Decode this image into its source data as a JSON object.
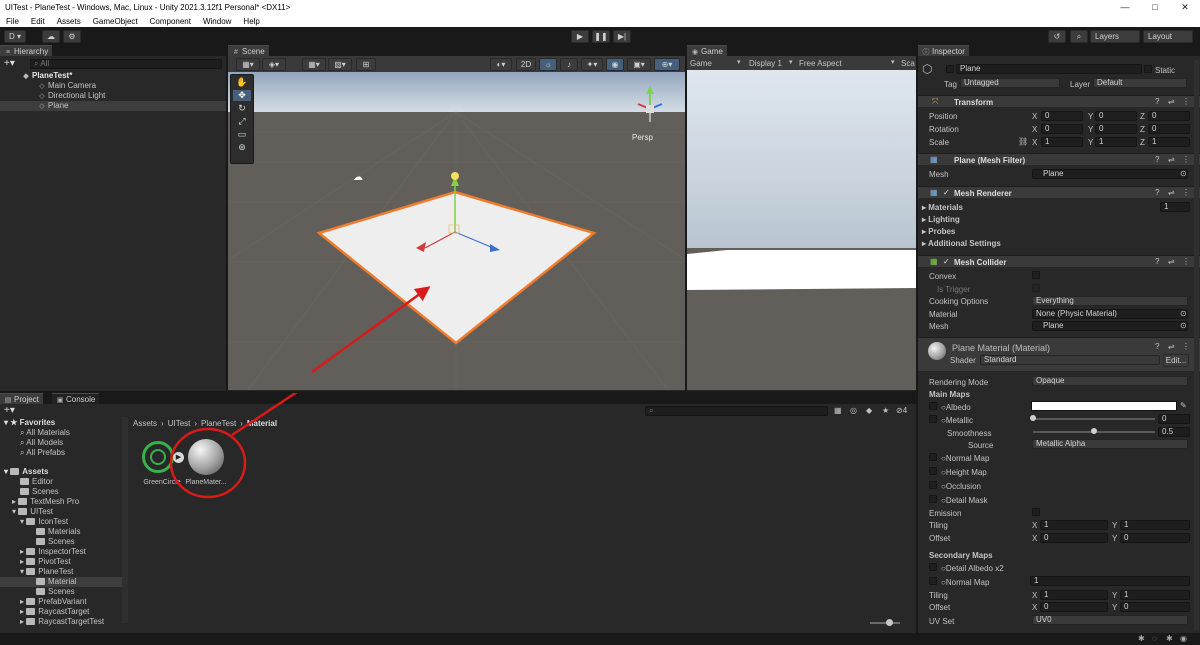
{
  "window": {
    "title": "UITest - PlaneTest - Windows, Mac, Linux - Unity 2021.3.12f1 Personal* <DX11>",
    "minimize": "—",
    "maximize": "□",
    "close": "✕"
  },
  "menu": [
    "File",
    "Edit",
    "Assets",
    "GameObject",
    "Component",
    "Window",
    "Help"
  ],
  "toolbar": {
    "account": "D ▾",
    "play": "▶",
    "pause": "❚❚",
    "step": "▶|",
    "layers": "Layers",
    "layout": "Layout"
  },
  "hierarchy": {
    "tab": "Hierarchy",
    "search_placeholder": "All",
    "scene": "PlaneTest*",
    "items": [
      "Main Camera",
      "Directional Light",
      "Plane"
    ]
  },
  "scene_view": {
    "tab": "Scene",
    "mode_2d": "2D",
    "persp": "Persp"
  },
  "game_view": {
    "tab": "Game",
    "mode": "Game",
    "display": "Display 1",
    "aspect": "Free Aspect",
    "scale": "Sca"
  },
  "inspector": {
    "tab": "Inspector",
    "name": "Plane",
    "static": "Static",
    "tag_label": "Tag",
    "tag": "Untagged",
    "layer_label": "Layer",
    "layer": "Default",
    "transform": {
      "title": "Transform",
      "rows": [
        {
          "label": "Position",
          "x": "0",
          "y": "0",
          "z": "0"
        },
        {
          "label": "Rotation",
          "x": "0",
          "y": "0",
          "z": "0"
        },
        {
          "label": "Scale",
          "x": "1",
          "y": "1",
          "z": "1"
        }
      ],
      "axis_x": "X",
      "axis_y": "Y",
      "axis_z": "Z"
    },
    "mesh_filter": {
      "title": "Plane (Mesh Filter)",
      "mesh_label": "Mesh",
      "mesh": "Plane"
    },
    "mesh_renderer": {
      "title": "Mesh Renderer",
      "materials": "Materials",
      "materials_count": "1",
      "lighting": "Lighting",
      "probes": "Probes",
      "additional": "Additional Settings"
    },
    "mesh_collider": {
      "title": "Mesh Collider",
      "convex": "Convex",
      "is_trigger": "Is Trigger",
      "cooking_label": "Cooking Options",
      "cooking": "Everything",
      "material_label": "Material",
      "material": "None (Physic Material)",
      "mesh_label": "Mesh",
      "mesh": "Plane"
    },
    "material": {
      "title": "Plane Material (Material)",
      "shader_label": "Shader",
      "shader": "Standard",
      "edit": "Edit...",
      "rendering_mode_label": "Rendering Mode",
      "rendering_mode": "Opaque",
      "main_maps": "Main Maps",
      "albedo": "Albedo",
      "metallic": "Metallic",
      "metallic_value": "0",
      "smoothness": "Smoothness",
      "smoothness_value": "0.5",
      "source_label": "Source",
      "source": "Metallic Alpha",
      "normal_map": "Normal Map",
      "height_map": "Height Map",
      "occlusion": "Occlusion",
      "detail_mask": "Detail Mask",
      "emission": "Emission",
      "tiling": "Tiling",
      "tiling_x": "1",
      "tiling_y": "1",
      "offset": "Offset",
      "offset_x": "0",
      "offset_y": "0",
      "secondary_maps": "Secondary Maps",
      "detail_albedo": "Detail Albedo x2",
      "sec_normal_map": "Normal Map",
      "sec_normal_value": "1",
      "sec_tiling": "Tiling",
      "sec_tiling_x": "1",
      "sec_tiling_y": "1",
      "sec_offset": "Offset",
      "sec_offset_x": "0",
      "sec_offset_y": "0",
      "uv_set_label": "UV Set",
      "uv_set": "UV0"
    }
  },
  "project": {
    "tab": "Project",
    "console_tab": "Console",
    "favorites": "Favorites",
    "favorite_items": [
      "All Materials",
      "All Models",
      "All Prefabs"
    ],
    "assets": "Assets",
    "tree": [
      {
        "label": "Editor",
        "indent": 1
      },
      {
        "label": "Scenes",
        "indent": 1
      },
      {
        "label": "TextMesh Pro",
        "indent": 1
      },
      {
        "label": "UITest",
        "indent": 1
      },
      {
        "label": "IconTest",
        "indent": 2
      },
      {
        "label": "Materials",
        "indent": 3
      },
      {
        "label": "Scenes",
        "indent": 3
      },
      {
        "label": "InspectorTest",
        "indent": 2
      },
      {
        "label": "PivotTest",
        "indent": 2
      },
      {
        "label": "PlaneTest",
        "indent": 2
      },
      {
        "label": "Material",
        "indent": 3
      },
      {
        "label": "Scenes",
        "indent": 3
      },
      {
        "label": "PrefabVariant",
        "indent": 2
      },
      {
        "label": "RaycastTarget",
        "indent": 2
      },
      {
        "label": "RaycastTargetTest",
        "indent": 2
      }
    ],
    "breadcrumb": [
      "Assets",
      "UITest",
      "PlaneTest",
      "Material"
    ],
    "asset_items": [
      "GreenCircle",
      "PlaneMater..."
    ],
    "hidden_count": "4"
  }
}
